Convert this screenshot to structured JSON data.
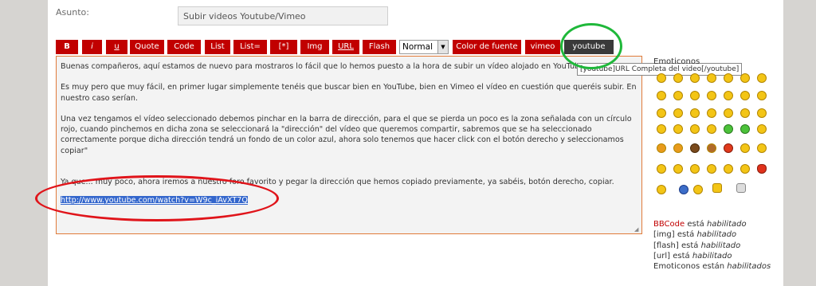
{
  "subject": {
    "label": "Asunto:",
    "value": "Subir videos Youtube/Vimeo"
  },
  "toolbar": {
    "buttons": [
      "B",
      "i",
      "u",
      "Quote",
      "Code",
      "List",
      "List=",
      "[*]",
      "Img",
      "URL",
      "Flash"
    ],
    "font_size": "Normal",
    "after": [
      "Color de fuente",
      "vimeo",
      "youtube"
    ]
  },
  "editor": {
    "p1": "Buenas compañeros, aquí estamos de nuevo para mostraros lo fácil que lo hemos puesto a la hora de subir un vídeo alojado en YouTube o",
    "p2": "Es muy pero que muy fácil, en primer lugar simplemente tenéis que buscar bien en YouTube, bien en Vimeo el vídeo en cuestión que queréis subir. En nuestro caso serían.",
    "p3": "Una vez tengamos el vídeo seleccionado debemos pinchar en la barra de dirección, para el que se pierda un poco es la zona señalada con un círculo rojo, cuando pinchemos en dicha zona se seleccionará la \"dirección\" del vídeo que queremos compartir, sabremos que se ha seleccionado correctamente porque dicha dirección tendrá un fondo de un color azul, ahora solo tenemos que hacer click con el botón derecho y seleccionamos copiar\"",
    "p4": "Ya que... muy poco, ahora iremos a nuestro foro favorito y pegar la dirección que hemos copiado previamente, ya sabéis, botón derecho, copiar.",
    "link": "http://www.youtube.com/watch?v=W9c_iAvXT7Q"
  },
  "tooltip": "[youtube]URL Completa del video[/youtube]",
  "emoticons": {
    "title": "Emoticonos"
  },
  "status": [
    {
      "tag": "BBCode",
      "text": " está ",
      "state": "habilitado"
    },
    {
      "tag": "[img]",
      "text": " está ",
      "state": "habilitado"
    },
    {
      "tag": "[flash]",
      "text": " está ",
      "state": "habilitado"
    },
    {
      "tag": "[url]",
      "text": " está ",
      "state": "habilitado"
    },
    {
      "tag": "Emoticonos",
      "text": " están ",
      "state": "habilitados"
    }
  ],
  "colors": {
    "button": "#c10000",
    "youtube_button": "#3a3a3a",
    "editor_border": "#e07b3a",
    "selection": "#3366cc"
  }
}
